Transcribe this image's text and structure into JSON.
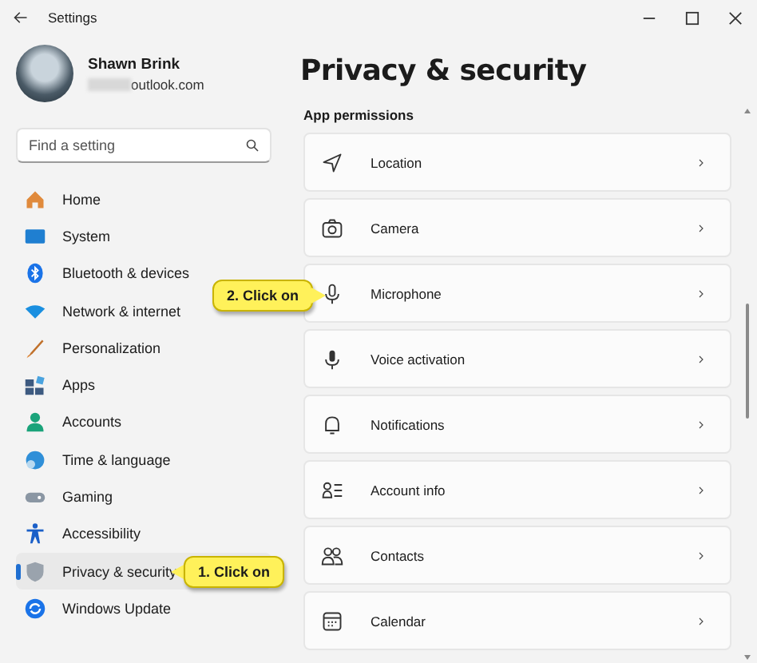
{
  "window": {
    "title": "Settings"
  },
  "profile": {
    "name": "Shawn Brink",
    "email": "outlook.com"
  },
  "search": {
    "placeholder": "Find a setting"
  },
  "sidebar": {
    "items": [
      {
        "label": "Home",
        "selected": false
      },
      {
        "label": "System",
        "selected": false
      },
      {
        "label": "Bluetooth & devices",
        "selected": false
      },
      {
        "label": "Network & internet",
        "selected": false
      },
      {
        "label": "Personalization",
        "selected": false
      },
      {
        "label": "Apps",
        "selected": false
      },
      {
        "label": "Accounts",
        "selected": false
      },
      {
        "label": "Time & language",
        "selected": false
      },
      {
        "label": "Gaming",
        "selected": false
      },
      {
        "label": "Accessibility",
        "selected": false
      },
      {
        "label": "Privacy & security",
        "selected": true
      },
      {
        "label": "Windows Update",
        "selected": false
      }
    ]
  },
  "page": {
    "title": "Privacy & security",
    "section": "App permissions",
    "items": [
      {
        "label": "Location"
      },
      {
        "label": "Camera"
      },
      {
        "label": "Microphone"
      },
      {
        "label": "Voice activation"
      },
      {
        "label": "Notifications"
      },
      {
        "label": "Account info"
      },
      {
        "label": "Contacts"
      },
      {
        "label": "Calendar"
      }
    ]
  },
  "callouts": [
    {
      "text": "2. Click on",
      "kind": "point-right"
    },
    {
      "text": "1. Click on",
      "kind": "point-left"
    }
  ]
}
